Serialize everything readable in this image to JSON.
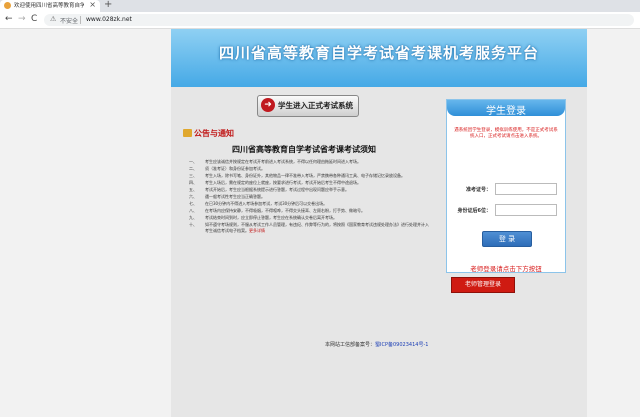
{
  "browser": {
    "tab_title": "欢迎使用四川省高等教育自学考",
    "tab_close": "×",
    "new_tab": "+",
    "back": "←",
    "forward": "→",
    "reload": "C",
    "security_label": "不安全",
    "url": "www.028zk.net"
  },
  "header": {
    "title": "四川省高等教育自学考试省考课机考服务平台"
  },
  "enter_button": {
    "label": "学生进入正式考试系统",
    "arrow": "➜"
  },
  "notice": {
    "heading": "公告与通知",
    "title": "四川省高等教育自学考试省考课考试须知",
    "rules": [
      {
        "num": "一、",
        "text": "考生应该诚信并按规定在考试开考前进入考试系统，不得以任何理由拖延时间进入考场。"
      },
      {
        "num": "二、",
        "text": "须（准考证）和身份证参加考试。"
      },
      {
        "num": "三、",
        "text": "考生入场，除书写笔、身份证外，其他物品一律不准带入考场，严禁携带各种通讯工具、电子存储记忆录放设备。"
      },
      {
        "num": "四、",
        "text": "考生入场后，需在规定的座位上就座，按要求进行考试，考试开始后考生不得中途退场。"
      },
      {
        "num": "五、",
        "text": "考试开始后，考生应当根据系统提示进行答题，考试过程中出现问题应举手示意。"
      },
      {
        "num": "六、",
        "text": "遇一般考试性考生应当正确答题。"
      },
      {
        "num": "七、",
        "text": "在已30分钟内不得进入考场参加考试，考试30分钟后可以交卷出场。"
      },
      {
        "num": "八、",
        "text": "在考场内应保持安静，不得吸烟，不得喧哗，不得交头接耳、左顾右盼，打手势、做暗号。"
      },
      {
        "num": "九、",
        "text": "考试结束时间到时，应立即停止答题，考生应在系统确认交卷后离开考场。"
      },
      {
        "num": "十、",
        "text": "如不遵守考场规则，不服从考试工作人员管理，有违纪、作弊等行为的，将按照《国家教育考试违规处理办法》进行处理并计入考生诚信考试电子档案。"
      }
    ],
    "more_link": "更多详情"
  },
  "footer": {
    "prefix": "本网站工信部备案号：",
    "icp": "蜀ICP备09023414号-1"
  },
  "login": {
    "title": "学生登录",
    "notice": "遇系统因学生登录，模拟训练使用，不是正式考试系统入口，正式考试请点击进入系统。",
    "exam_id_label": "准考证号：",
    "id_card_label": "身份证后6位：",
    "submit": "登 录",
    "teacher_note": "老师登录请点击下方按钮",
    "teacher_button": "老师管理登录"
  }
}
